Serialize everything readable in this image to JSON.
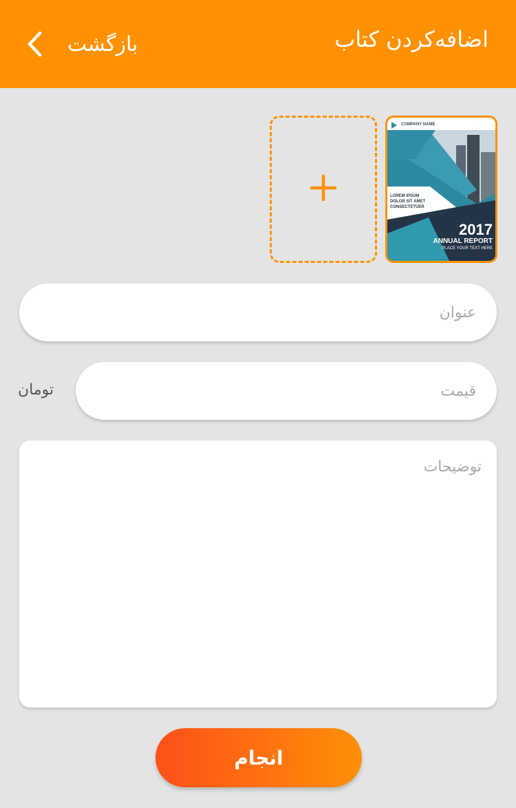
{
  "header": {
    "title": "اضافه‌کردن کتاب",
    "back_label": "بازگشت",
    "background_color": "#ff9102"
  },
  "images": {
    "cover": {
      "company": "COMPANY NAME",
      "lorem": [
        "LOREM IPSUM",
        "DOLOR SIT AMET",
        "CONSECTETUER"
      ],
      "year": "2017",
      "report": "ANNUAL REPORT",
      "tagline": "PLACE YOUR TEXT HERE"
    },
    "add_icon": "plus-icon"
  },
  "form": {
    "title_placeholder": "عنوان",
    "title_value": "",
    "price_placeholder": "قیمت",
    "price_value": "",
    "currency": "تومان",
    "description_placeholder": "توضیحات",
    "description_value": ""
  },
  "actions": {
    "submit_label": "انجام"
  },
  "colors": {
    "accent": "#ff9102",
    "gradient_start": "#ff5019",
    "gradient_end": "#ff8f08",
    "page_background": "#e4e4e4"
  }
}
